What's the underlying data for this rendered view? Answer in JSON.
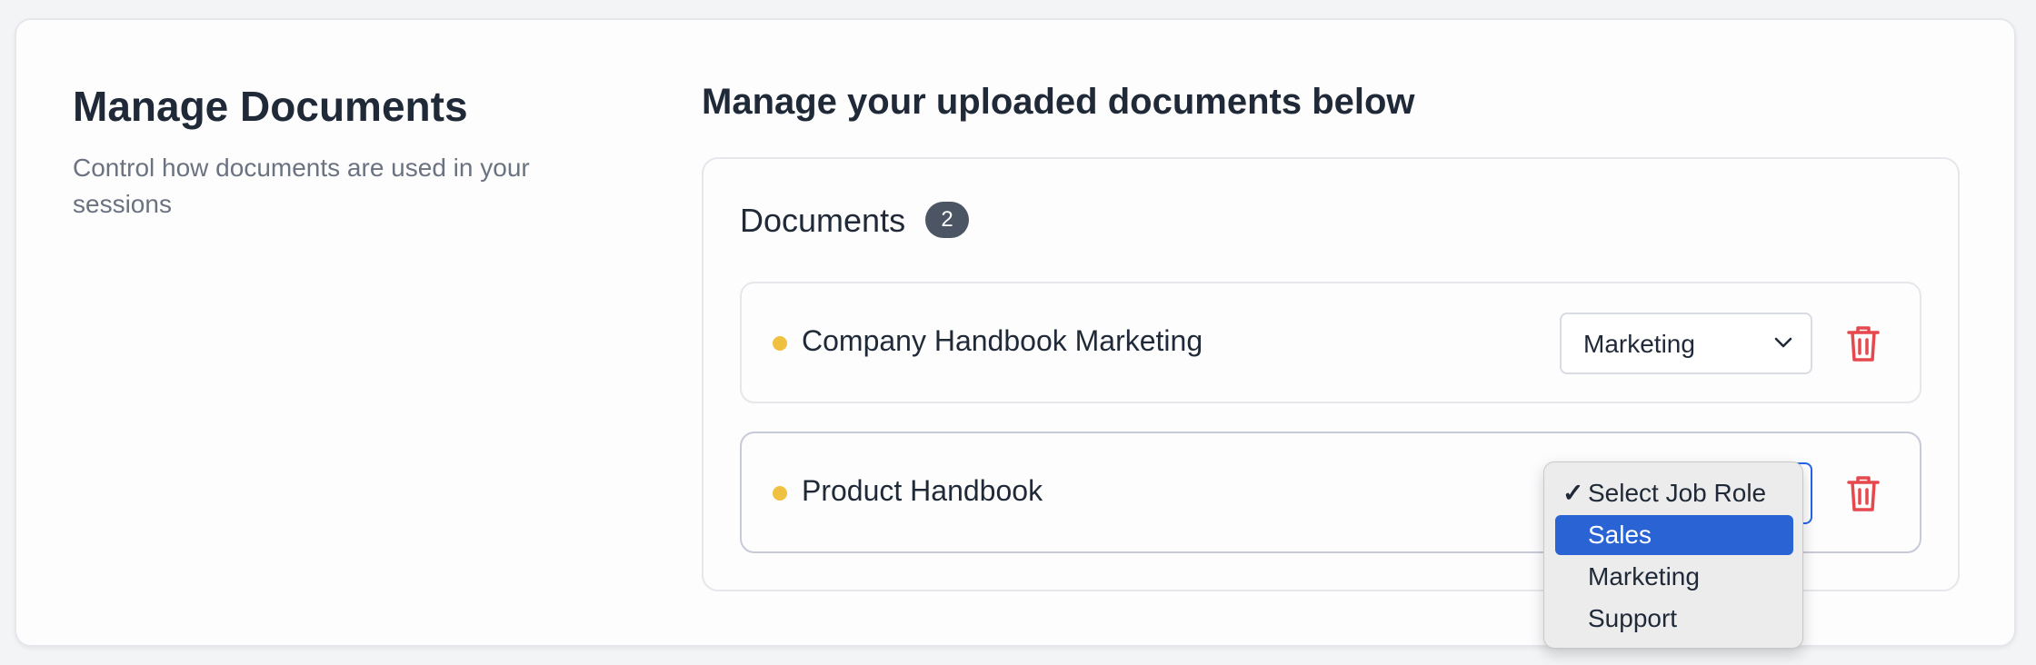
{
  "left": {
    "title": "Manage Documents",
    "subtitle": "Control how documents are used in your sessions"
  },
  "right": {
    "heading": "Manage your uploaded documents below",
    "documents_title": "Documents",
    "documents_count": "2"
  },
  "documents": [
    {
      "name": "Company Handbook Marketing",
      "role": "Marketing",
      "status_color": "#f0c040"
    },
    {
      "name": "Product Handbook",
      "role": "Select Job Role",
      "status_color": "#f0c040"
    }
  ],
  "dropdown": {
    "checkmark": "✓",
    "options": [
      "Select Job Role",
      "Sales",
      "Marketing",
      "Support"
    ],
    "checked_option": "Select Job Role",
    "highlighted_option": "Sales"
  },
  "colors": {
    "highlight": "#2a63d4",
    "badge": "#4b5563",
    "delete": "#e5484d",
    "status_dot": "#f0c040"
  },
  "icons": {
    "delete": "trash-icon",
    "select_arrow": "chevron-down-icon",
    "status": "status-dot"
  }
}
